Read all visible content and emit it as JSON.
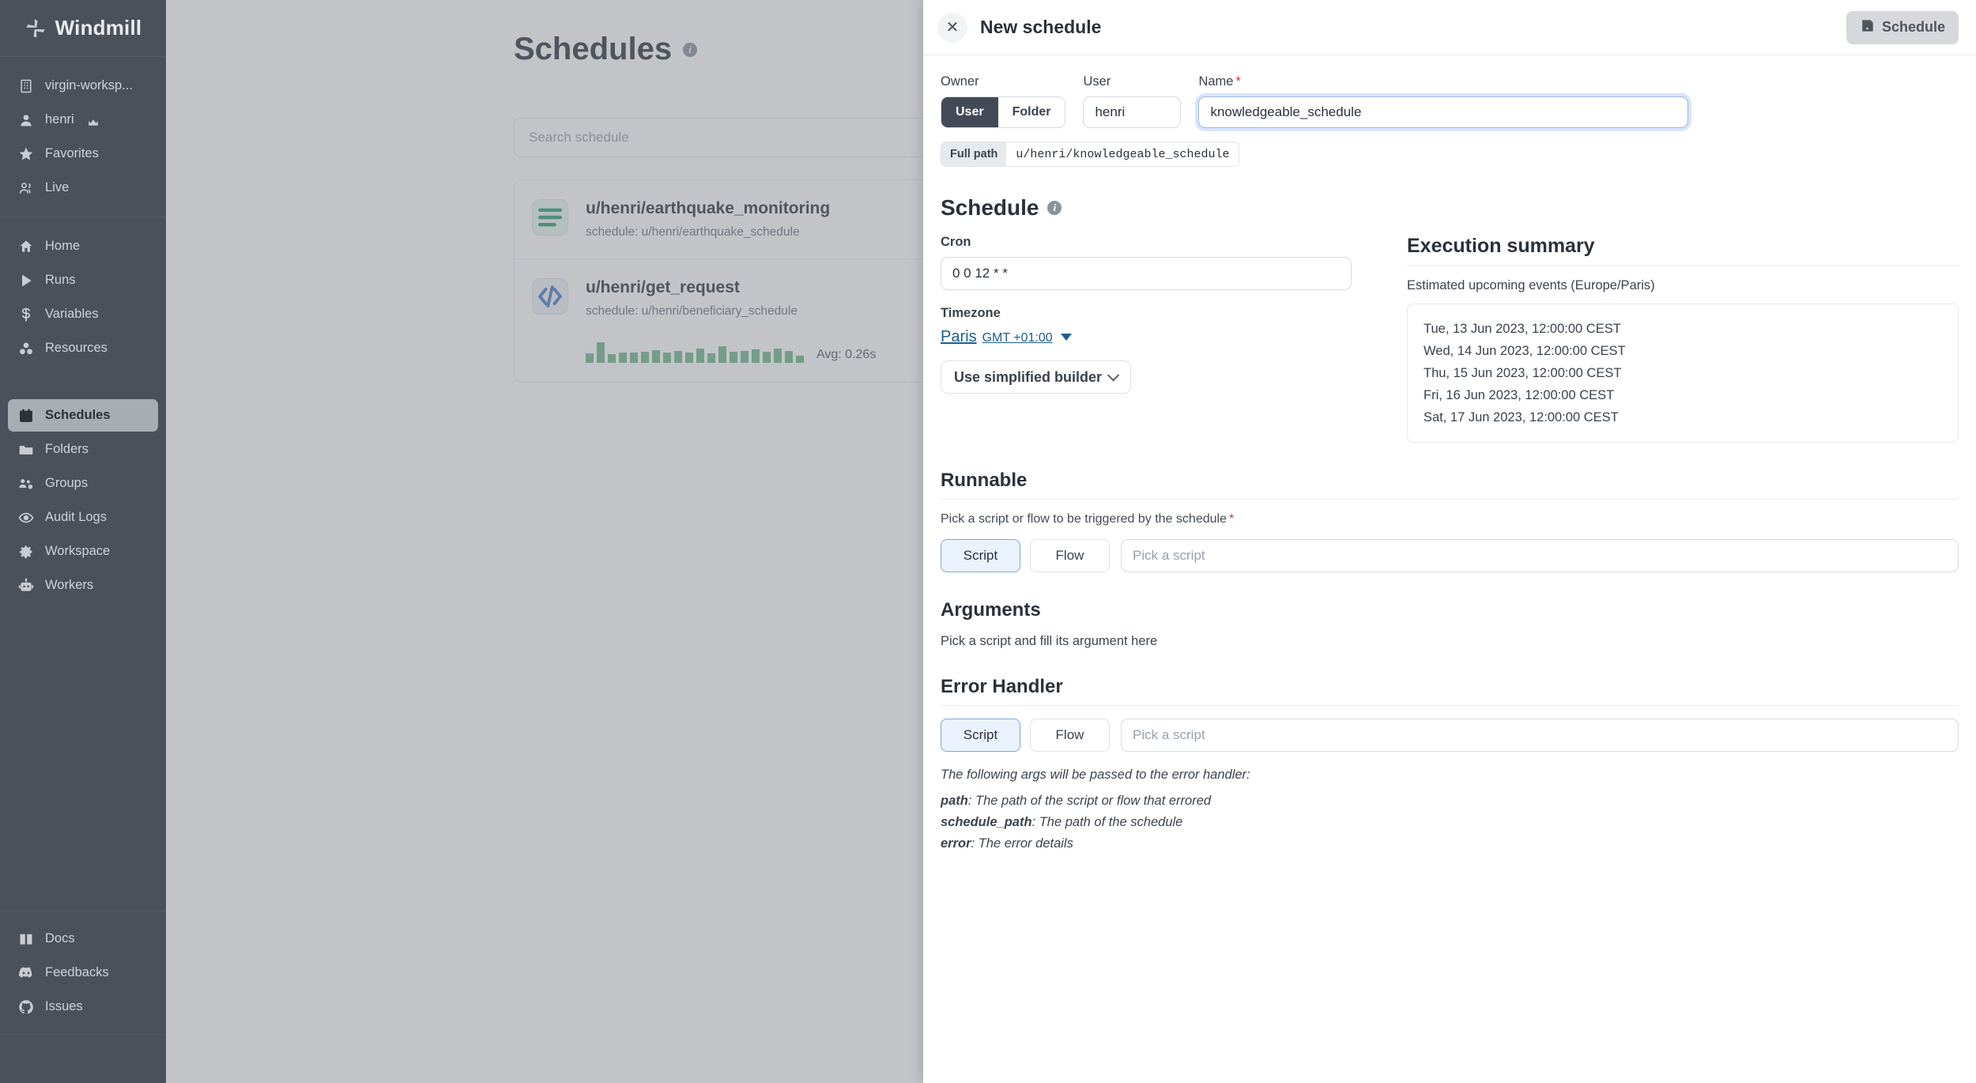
{
  "sidebar": {
    "brand": "Windmill",
    "groups": [
      {
        "items": [
          {
            "label": "virgin-worksp...",
            "icon": "building-icon",
            "active": false
          },
          {
            "label": "henri",
            "icon": "user-icon",
            "badge": "crown-icon",
            "active": false
          },
          {
            "label": "Favorites",
            "icon": "star-icon",
            "active": false
          },
          {
            "label": "Live",
            "icon": "users-icon",
            "active": false
          }
        ]
      },
      {
        "items": [
          {
            "label": "Home",
            "icon": "home-icon",
            "active": false
          },
          {
            "label": "Runs",
            "icon": "play-icon",
            "active": false
          },
          {
            "label": "Variables",
            "icon": "dollar-icon",
            "active": false
          },
          {
            "label": "Resources",
            "icon": "resources-icon",
            "active": false
          }
        ]
      },
      {
        "items": [
          {
            "label": "Schedules",
            "icon": "calendar-icon",
            "active": true
          },
          {
            "label": "Folders",
            "icon": "folder-icon",
            "active": false
          },
          {
            "label": "Groups",
            "icon": "groups-icon",
            "active": false
          },
          {
            "label": "Audit Logs",
            "icon": "eye-icon",
            "active": false
          },
          {
            "label": "Workspace",
            "icon": "gear-icon",
            "active": false
          },
          {
            "label": "Workers",
            "icon": "robot-icon",
            "active": false
          }
        ]
      },
      {
        "items": [
          {
            "label": "Docs",
            "icon": "book-icon",
            "active": false
          },
          {
            "label": "Feedbacks",
            "icon": "discord-icon",
            "active": false
          },
          {
            "label": "Issues",
            "icon": "github-icon",
            "active": false
          }
        ]
      }
    ]
  },
  "page": {
    "title": "Schedules",
    "search_placeholder": "Search schedule",
    "schedules": [
      {
        "name": "u/henri/earthquake_monitoring",
        "sub": "schedule: u/henri/earthquake_schedule",
        "kind": "flow"
      },
      {
        "name": "u/henri/get_request",
        "sub": "schedule: u/henri/beneficiary_schedule",
        "kind": "script",
        "avg_label": "Avg: 0.26s",
        "sparkline": [
          12,
          26,
          11,
          13,
          13,
          14,
          16,
          13,
          15,
          13,
          18,
          12,
          21,
          14,
          15,
          17,
          14,
          18,
          15,
          9
        ]
      }
    ]
  },
  "drawer": {
    "title": "New schedule",
    "close_icon": "close-icon",
    "save_button": {
      "label": "Schedule",
      "icon": "save-icon"
    },
    "owner": {
      "label": "Owner",
      "options": [
        "User",
        "Folder"
      ],
      "selected": "User"
    },
    "user": {
      "label": "User",
      "value": "henri"
    },
    "name": {
      "label": "Name",
      "required": "*",
      "value": "knowledgeable_schedule"
    },
    "full_path": {
      "key": "Full path",
      "value": "u/henri/knowledgeable_schedule"
    },
    "schedule_section": {
      "heading": "Schedule",
      "cron_label": "Cron",
      "cron_value": "0 0 12 * *",
      "timezone_label": "Timezone",
      "timezone_city": "Paris",
      "timezone_offset": "GMT +01:00",
      "builder_button": "Use simplified builder"
    },
    "execution_summary": {
      "heading": "Execution summary",
      "subtitle": "Estimated upcoming events (Europe/Paris)",
      "events": [
        "Tue, 13 Jun 2023, 12:00:00 CEST",
        "Wed, 14 Jun 2023, 12:00:00 CEST",
        "Thu, 15 Jun 2023, 12:00:00 CEST",
        "Fri, 16 Jun 2023, 12:00:00 CEST",
        "Sat, 17 Jun 2023, 12:00:00 CEST"
      ]
    },
    "runnable": {
      "heading": "Runnable",
      "helper": "Pick a script or flow to be triggered by the schedule",
      "required": "*",
      "options": [
        "Script",
        "Flow"
      ],
      "selected": "Script",
      "picker_placeholder": "Pick a script"
    },
    "arguments": {
      "heading": "Arguments",
      "note": "Pick a script and fill its argument here"
    },
    "error_handler": {
      "heading": "Error Handler",
      "options": [
        "Script",
        "Flow"
      ],
      "selected": "Script",
      "picker_placeholder": "Pick a script",
      "note": "The following args will be passed to the error handler:",
      "args": [
        {
          "key": "path",
          "desc": ": The path of the script or flow that errored"
        },
        {
          "key": "schedule_path",
          "desc": ": The path of the schedule"
        },
        {
          "key": "error",
          "desc": ": The error details"
        }
      ]
    }
  },
  "colors": {
    "sidebar_bg": "#4b515b",
    "accent_blue": "#7ba7e0",
    "flow_green": "#2f9e72",
    "script_blue": "#4a7bc8",
    "required_red": "#e03131"
  }
}
